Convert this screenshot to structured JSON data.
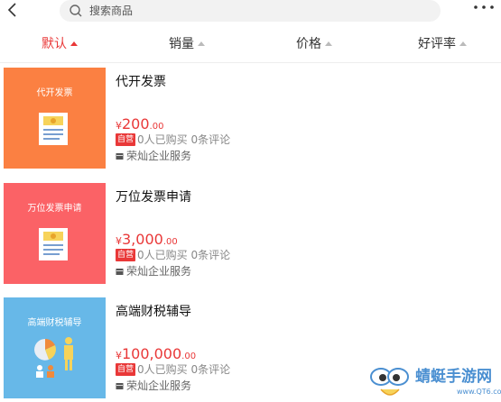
{
  "search": {
    "placeholder": "搜索商品"
  },
  "sort_tabs": [
    {
      "label": "默认",
      "active": true
    },
    {
      "label": "销量",
      "active": false
    },
    {
      "label": "价格",
      "active": false
    },
    {
      "label": "好评率",
      "active": false
    }
  ],
  "products": [
    {
      "thumb_title": "代开发票",
      "thumb_color": "#fb8042",
      "name": "代开发票",
      "currency": "¥",
      "price_main": "200",
      "price_dec": ".00",
      "badge": "自营",
      "meta": "0人已购买 0条评论",
      "shop": "荣灿企业服务"
    },
    {
      "thumb_title": "万位发票申请",
      "thumb_color": "#fb6266",
      "name": "万位发票申请",
      "currency": "¥",
      "price_main": "3,000",
      "price_dec": ".00",
      "badge": "自营",
      "meta": "0人已购买 0条评论",
      "shop": "荣灿企业服务"
    },
    {
      "thumb_title": "高端财税辅导",
      "thumb_color": "#67b8e8",
      "name": "高端财税辅导",
      "currency": "¥",
      "price_main": "100,000",
      "price_dec": ".00",
      "badge": "自营",
      "meta": "0人已购买 0条评论",
      "shop": "荣灿企业服务"
    }
  ],
  "watermark": {
    "text": "蜻蜓手游网",
    "url": "www.QT6.com"
  },
  "colors": {
    "accent": "#e93838"
  }
}
